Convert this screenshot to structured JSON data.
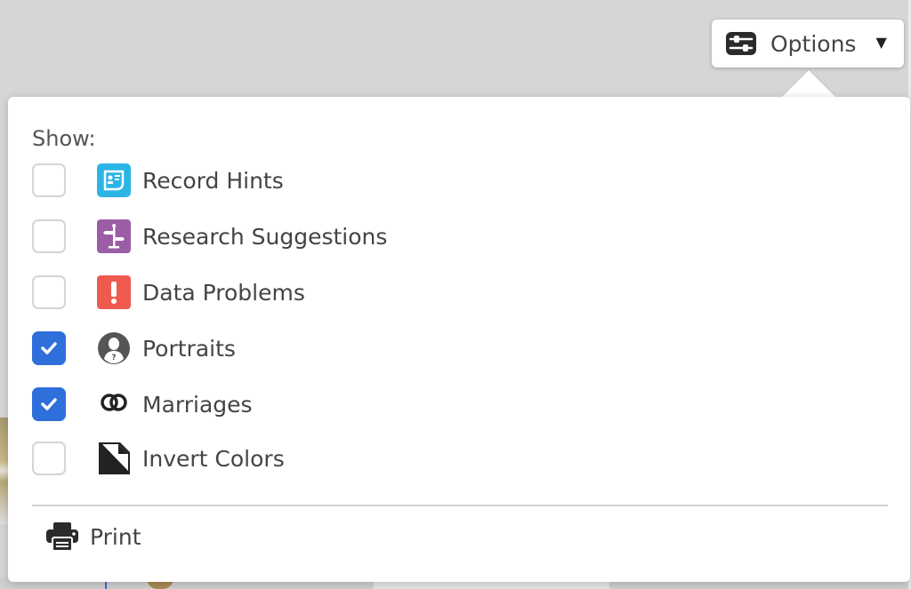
{
  "options_button": {
    "label": "Options",
    "icon": "sliders-icon",
    "caret": "▼"
  },
  "panel": {
    "show_label": "Show:",
    "items": [
      {
        "label": "Record Hints",
        "icon": "record-hints-icon",
        "icon_color": "#2bb5e5",
        "checked": false
      },
      {
        "label": "Research Suggestions",
        "icon": "research-suggestions-icon",
        "icon_color": "#9b5ea6",
        "checked": false
      },
      {
        "label": "Data Problems",
        "icon": "data-problems-icon",
        "icon_color": "#ef5a4f",
        "checked": false
      },
      {
        "label": "Portraits",
        "icon": "portrait-icon",
        "icon_color": "#555555",
        "checked": true
      },
      {
        "label": "Marriages",
        "icon": "marriage-rings-icon",
        "icon_color": "#222222",
        "checked": true
      },
      {
        "label": "Invert Colors",
        "icon": "invert-colors-icon",
        "icon_color": "#222222",
        "checked": false
      }
    ],
    "print_label": "Print",
    "print_icon": "printer-icon"
  },
  "colors": {
    "checkbox_checked": "#2f6fdc",
    "checkbox_border": "#d4d4d4"
  }
}
